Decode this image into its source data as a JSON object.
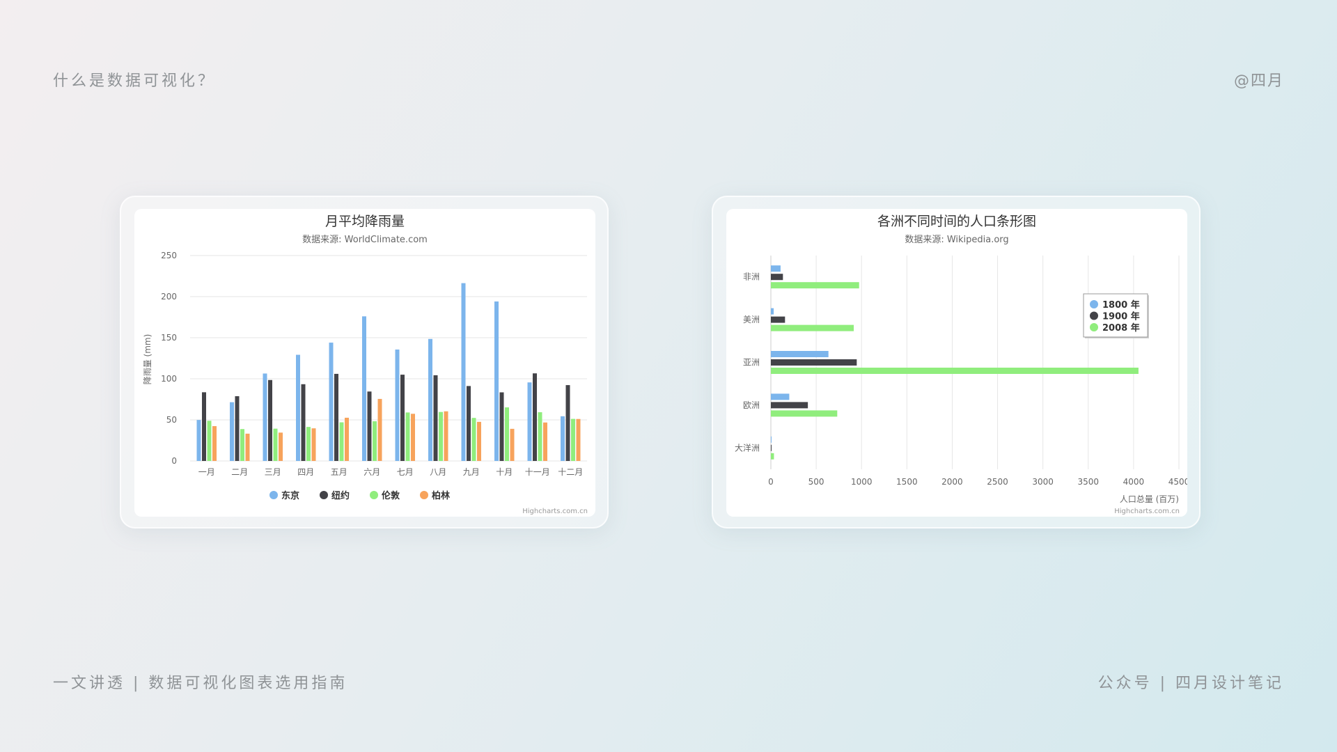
{
  "page": {
    "top_left": "什么是数据可视化？",
    "top_right": "@四月",
    "bottom_left": "一文讲透 | 数据可视化图表选用指南",
    "bottom_right": "公众号 | 四月设计笔记"
  },
  "chart_data": [
    {
      "type": "bar",
      "title": "月平均降雨量",
      "subtitle": "数据来源: WorldClimate.com",
      "ylabel": "降雨量 (mm)",
      "xlabel": "",
      "ylim": [
        0,
        250
      ],
      "yticks": [
        "0",
        "50",
        "100",
        "150",
        "200",
        "250"
      ],
      "grid": true,
      "legend_position": "bottom",
      "credit": "Highcharts.com.cn",
      "categories": [
        "一月",
        "二月",
        "三月",
        "四月",
        "五月",
        "六月",
        "七月",
        "八月",
        "九月",
        "十月",
        "十一月",
        "十二月"
      ],
      "series": [
        {
          "name": "东京",
          "color": "#7cb5ec",
          "values": [
            49.9,
            71.5,
            106.4,
            129.2,
            144.0,
            176.0,
            135.6,
            148.5,
            216.4,
            194.1,
            95.6,
            54.4
          ]
        },
        {
          "name": "纽约",
          "color": "#434348",
          "values": [
            83.6,
            78.8,
            98.5,
            93.4,
            106.0,
            84.5,
            105.0,
            104.3,
            91.2,
            83.5,
            106.6,
            92.3
          ]
        },
        {
          "name": "伦敦",
          "color": "#90ed7d",
          "values": [
            48.9,
            38.8,
            39.3,
            41.4,
            47.0,
            48.3,
            59.0,
            59.6,
            52.4,
            65.2,
            59.3,
            51.2
          ]
        },
        {
          "name": "柏林",
          "color": "#f7a35c",
          "values": [
            42.4,
            33.2,
            34.5,
            39.7,
            52.6,
            75.5,
            57.4,
            60.4,
            47.6,
            39.1,
            46.8,
            51.1
          ]
        }
      ]
    },
    {
      "type": "bar",
      "orientation": "horizontal",
      "title": "各洲不同时间的人口条形图",
      "subtitle": "数据来源: Wikipedia.org",
      "xlabel": "人口总量 (百万)",
      "ylabel": "",
      "xlim": [
        0,
        4500
      ],
      "xticks": [
        "0",
        "500",
        "1000",
        "1500",
        "2000",
        "2500",
        "3000",
        "3500",
        "4000",
        "4500"
      ],
      "grid": true,
      "legend_position": "top-right",
      "credit": "Highcharts.com.cn",
      "categories": [
        "非洲",
        "美洲",
        "亚洲",
        "欧洲",
        "大洋洲"
      ],
      "series": [
        {
          "name": "1800 年",
          "color": "#7cb5ec",
          "values": [
            107,
            31,
            635,
            203,
            2
          ]
        },
        {
          "name": "1900 年",
          "color": "#434348",
          "values": [
            133,
            156,
            947,
            408,
            6
          ]
        },
        {
          "name": "2008 年",
          "color": "#90ed7d",
          "values": [
            973,
            914,
            4054,
            732,
            34
          ]
        }
      ]
    }
  ]
}
